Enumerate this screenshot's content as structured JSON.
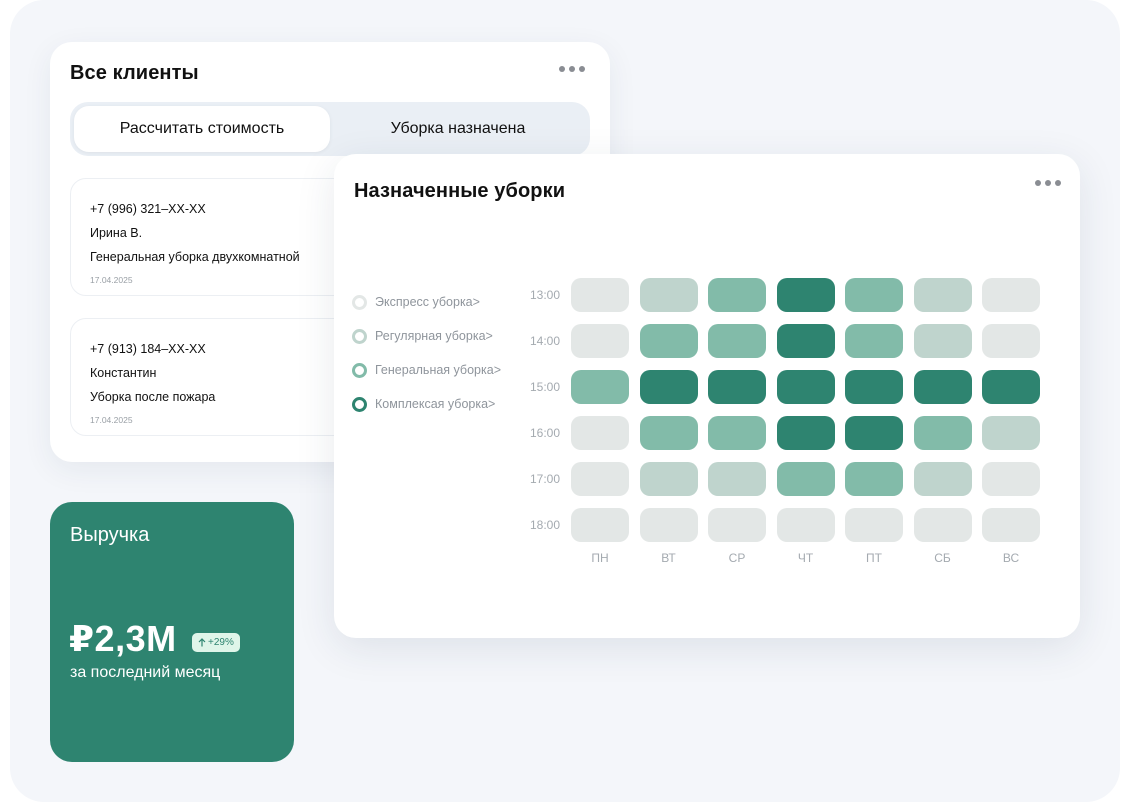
{
  "clients": {
    "title": "Все клиенты",
    "menu_icon": "more-horizontal-icon",
    "tabs": [
      {
        "label": "Рассчитать стоимость",
        "active": true
      },
      {
        "label": "Уборка назначена",
        "active": false
      }
    ],
    "items": [
      {
        "phone": "+7 (996) 321–XX-XX",
        "name": "Ирина В.",
        "service": "Генеральная уборка двухкомнатной",
        "date": "17.04.2025"
      },
      {
        "phone": "+7 (913) 184–XX-XX",
        "name": "Константин",
        "service": "Уборка после пожара",
        "date": "17.04.2025"
      }
    ]
  },
  "revenue": {
    "title": "Выручка",
    "value": "₽2,3M",
    "change": "+29%",
    "change_icon": "arrow-up-icon",
    "subtitle": "за последний месяц",
    "bg_color": "#2e8470"
  },
  "schedule": {
    "title": "Назначенные уборки",
    "menu_icon": "more-horizontal-icon",
    "legend": [
      {
        "label": "Экспресс уборка>",
        "color": "#e3e7e6"
      },
      {
        "label": "Регулярная уборка>",
        "color": "#bfd4cd"
      },
      {
        "label": "Генеральная уборка>",
        "color": "#82bba9"
      },
      {
        "label": "Комплексая уборка>",
        "color": "#2e8470"
      }
    ],
    "times": [
      "13:00",
      "14:00",
      "15:00",
      "16:00",
      "17:00",
      "18:00"
    ],
    "days": [
      "ПН",
      "ВТ",
      "СР",
      "ЧТ",
      "ПТ",
      "СБ",
      "ВС"
    ],
    "levels": [
      [
        0,
        1,
        2,
        3,
        2,
        1,
        0
      ],
      [
        0,
        2,
        2,
        3,
        2,
        1,
        0
      ],
      [
        2,
        3,
        3,
        3,
        3,
        3,
        3
      ],
      [
        0,
        2,
        2,
        3,
        3,
        2,
        1
      ],
      [
        0,
        1,
        1,
        2,
        2,
        1,
        0
      ],
      [
        0,
        0,
        0,
        0,
        0,
        0,
        0
      ]
    ]
  }
}
